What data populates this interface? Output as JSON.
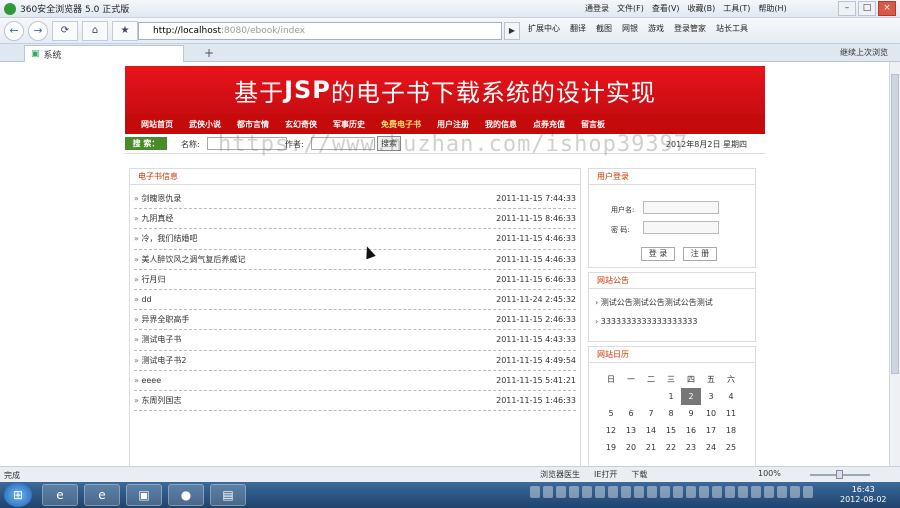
{
  "window": {
    "app_title": "360安全浏览器 5.0 正式版",
    "menus": [
      "通登录",
      "文件(F)",
      "查看(V)",
      "收藏(B)",
      "工具(T)",
      "帮助(H)"
    ]
  },
  "nav": {
    "url_host": "http://localhost",
    "url_rest": ":8080/ebook/index",
    "toolbar_items": [
      "扩展中心",
      "翻译",
      "截图",
      "网银",
      "游戏",
      "登录管家",
      "站长工具"
    ]
  },
  "tabs": [
    {
      "label": "系统"
    }
  ],
  "tab_right_label": "继续上次浏览",
  "site": {
    "banner_prefix": "基于",
    "banner_jsp": "JSP",
    "banner_suffix": "的电子书下载系统的设计实现",
    "menu": [
      "网站首页",
      "武侠小说",
      "都市言情",
      "玄幻奇侠",
      "军事历史",
      "免费电子书",
      "用户注册",
      "我的信息",
      "点券充值",
      "留言板"
    ],
    "search": {
      "tag": "搜 索：",
      "name_label": "名称:",
      "author_label": "作者:",
      "button": "搜索",
      "date": "2012年8月2日 星期四"
    },
    "books_title": "电子书信息",
    "books": [
      {
        "name": "剑魄恩仇录",
        "date": "2011-11-15 7:44:33"
      },
      {
        "name": "九阴真经",
        "date": "2011-11-15 8:46:33"
      },
      {
        "name": "冷，我们结婚吧",
        "date": "2011-11-15 4:46:33"
      },
      {
        "name": "美人醉饮风之调气复后养威记",
        "date": "2011-11-15 4:46:33"
      },
      {
        "name": "行月归",
        "date": "2011-11-15 6:46:33"
      },
      {
        "name": "dd",
        "date": "2011-11-24 2:45:32"
      },
      {
        "name": "异界全职高手",
        "date": "2011-11-15 2:46:33"
      },
      {
        "name": "测试电子书",
        "date": "2011-11-15 4:43:33"
      },
      {
        "name": "测试电子书2",
        "date": "2011-11-15 4:49:54"
      },
      {
        "name": "eeee",
        "date": "2011-11-15 5:41:21"
      },
      {
        "name": "东周列国志",
        "date": "2011-11-15 1:46:33"
      }
    ],
    "login": {
      "title": "用户登录",
      "user_label": "用户名:",
      "pass_label": "密  码:",
      "login_btn": "登 录",
      "register_btn": "注 册"
    },
    "notice": {
      "title": "网站公告",
      "items": [
        "测试公告测试公告测试公告测试",
        "3333333333333333333"
      ]
    },
    "calendar": {
      "title": "网站日历",
      "weekdays": [
        "日",
        "一",
        "二",
        "三",
        "四",
        "五",
        "六"
      ],
      "days": [
        "",
        "",
        "",
        "1",
        "2",
        "3",
        "4",
        "5",
        "6",
        "7",
        "8",
        "9",
        "10",
        "11",
        "12",
        "13",
        "14",
        "15",
        "16",
        "17",
        "18",
        "19",
        "20",
        "21",
        "22",
        "23",
        "24",
        "25"
      ],
      "today": "2"
    }
  },
  "watermark": "https://www.huzhan.com/ishop39397",
  "status": {
    "left": "完成",
    "items": [
      "浏览器医生",
      "IE打开",
      "下载"
    ],
    "zoom": "100%"
  },
  "taskbar": {
    "time": "16:43",
    "date": "2012-08-02"
  }
}
